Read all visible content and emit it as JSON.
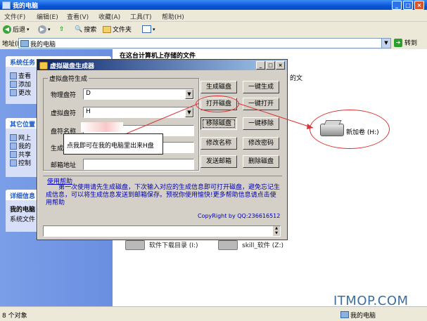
{
  "explorer": {
    "title": "我的电脑",
    "menu": [
      "文件(F)",
      "编辑(E)",
      "查看(V)",
      "收藏(A)",
      "工具(T)",
      "帮助(H)"
    ],
    "toolbar": {
      "back": "后退",
      "search": "搜索",
      "folders": "文件夹"
    },
    "address": {
      "label": "地址(D)",
      "value": "我的电脑",
      "go": "转到"
    },
    "left_panel": {
      "system_tasks": {
        "title": "系统任务",
        "items": [
          "查看",
          "添加",
          "更改"
        ]
      },
      "other_places": {
        "title": "其它位置",
        "items": [
          "网上",
          "我的",
          "共享",
          "控制"
        ]
      },
      "details": {
        "title": "详细信息",
        "name": "我的电脑",
        "desc": "系统文件"
      }
    },
    "content": {
      "section_title": "在这台计算机上存储的文件",
      "side_text": "的文",
      "drives_text": [
        "软件下载目录 (I:)",
        "skill_软件 (Z:)"
      ],
      "new_volume": "新加卷 (H:)"
    },
    "status": {
      "left": "8 个对象",
      "right": "我的电脑"
    }
  },
  "dialog": {
    "title": "虚拟磁盘生成器",
    "group_label": "虚拟盘符生成",
    "fields": {
      "physical_drive": {
        "label": "物理盘符",
        "value": "D"
      },
      "virtual_drive": {
        "label": "虚拟盘符",
        "value": "H"
      },
      "disk_name": {
        "label": "盘符名称",
        "value": ""
      },
      "generated": {
        "label": "生成"
      },
      "email": {
        "label": "邮箱地址",
        "value": ""
      }
    },
    "buttons": {
      "generate": "生成磁盘",
      "one_click_generate": "一键生成",
      "open": "打开磁盘",
      "one_click_open": "一键打开",
      "remove": "移除磁盘",
      "one_click_remove": "一键移除",
      "change_name": "修改名称",
      "change_password": "修改密码",
      "send_email": "发送邮箱",
      "delete": "删除磁盘"
    },
    "help": {
      "link": "使用帮助",
      "text": "第一次使用请先生成磁盘，下次输入对应的生成信息即可打开磁盘，避免忘记生成信息，可以将生成信息发送到邮箱保存。预祝你使用愉快!更多帮助信息请点击使用帮助",
      "copyright": "CopyRight by QQ:236616512"
    }
  },
  "callout": {
    "text": "点我即可在我的电脑里出来H盘"
  },
  "watermark": "ITMOP.COM"
}
